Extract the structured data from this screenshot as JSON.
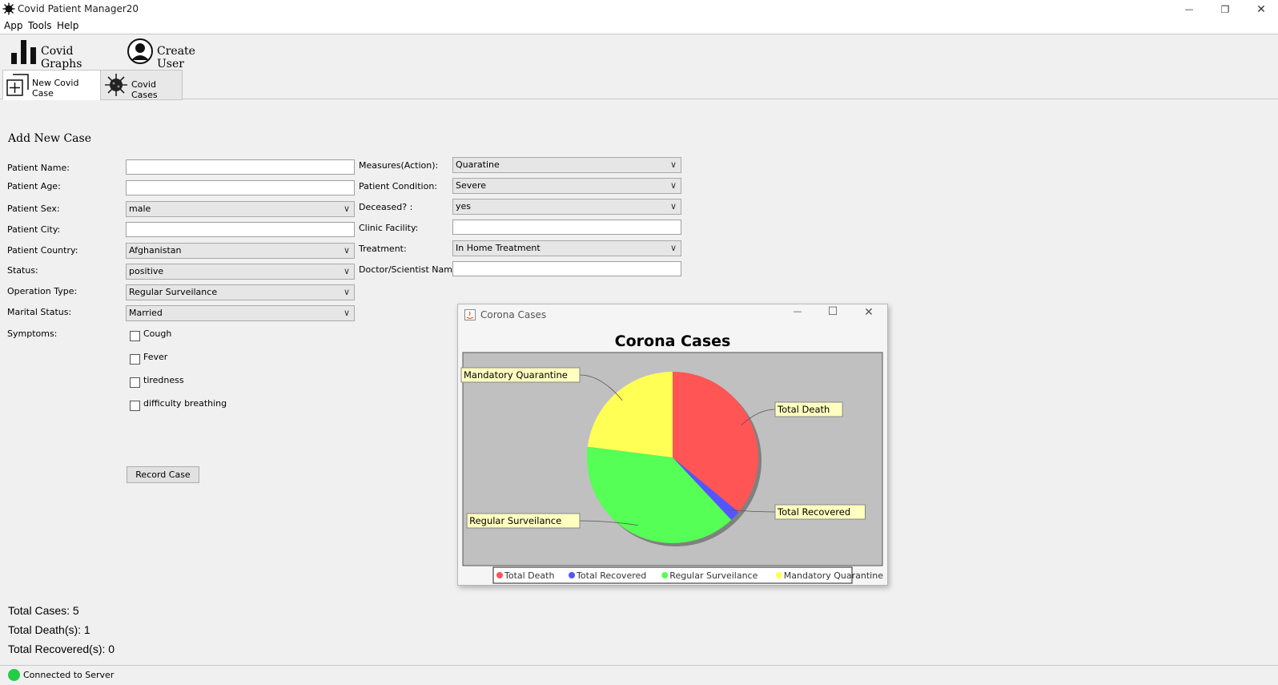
{
  "window": {
    "title": "Covid Patient Manager20",
    "minimize_glyph": "—",
    "restore_glyph": "❐",
    "close_glyph": "✕"
  },
  "menu": [
    "App",
    "Tools",
    "Help"
  ],
  "toolbar": {
    "graphs_label": "Covid Graphs",
    "create_user_label": "Create User"
  },
  "tabs": [
    {
      "label": "New Covid Case",
      "icon": "add-box-icon",
      "active": true
    },
    {
      "label": "Covid Cases",
      "icon": "virus-icon",
      "active": false
    }
  ],
  "form": {
    "heading": "Add New Case",
    "left_labels": {
      "name": "Patient Name:",
      "age": "Patient Age:",
      "sex": "Patient Sex:",
      "city": "Patient City:",
      "country": "Patient Country:",
      "status": "Status:",
      "operation": "Operation Type:",
      "marital": "Marital Status:",
      "symptoms": "Symptoms:"
    },
    "values": {
      "name": "",
      "age": "",
      "sex": "male",
      "city": "",
      "country": "Afghanistan",
      "status": "positive",
      "operation": "Regular Surveilance",
      "marital": "Married"
    },
    "symptoms": [
      "Cough",
      "Fever",
      "tiredness",
      "difficulty breathing"
    ],
    "right_labels": {
      "measures": "Measures(Action):",
      "condition": "Patient Condition:",
      "deceased": "Deceased? :",
      "clinic": "Clinic Facility:",
      "treatment": "Treatment:",
      "doctor": "Doctor/Scientist Name:"
    },
    "right_values": {
      "measures": "Quaratine",
      "condition": "Severe",
      "deceased": "yes",
      "clinic": "",
      "treatment": "In Home Treatment",
      "doctor": ""
    },
    "record_button": "Record Case",
    "chevron": "∨"
  },
  "stats": {
    "total_cases": "Total Cases: 5",
    "total_deaths": "Total Death(s): 1",
    "total_recovered": "Total Recovered(s): 0"
  },
  "chart_window": {
    "title": "Corona Cases",
    "minimize_glyph": "—",
    "maximize_glyph": "☐",
    "close_glyph": "✕"
  },
  "chart_data": {
    "type": "pie",
    "title": "Corona Cases",
    "categories": [
      "Total Death",
      "Total Recovered",
      "Regular Surveilance",
      "Mandatory Quarantine"
    ],
    "values": [
      36,
      2,
      39,
      23
    ],
    "colors": [
      "#ff5555",
      "#5555ff",
      "#55ff55",
      "#ffff55"
    ],
    "legend": "bottom",
    "plot_background": "#c0c0c0"
  },
  "statusbar": {
    "text": "Connected to Server",
    "indicator_color": "#22cc44"
  }
}
